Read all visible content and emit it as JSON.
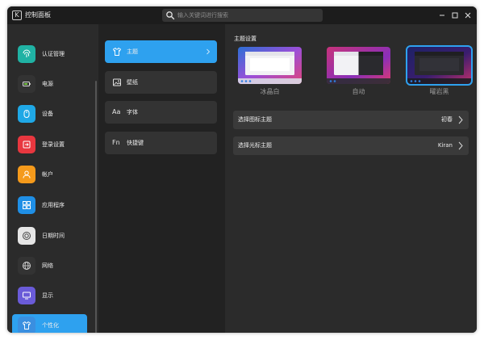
{
  "window": {
    "title": "控制面板",
    "logo_glyph": "K",
    "search_placeholder": "输入关键词进行搜索"
  },
  "sidebar": {
    "items": [
      {
        "label": "认证管理",
        "icon": "fingerprint-icon",
        "color": "#20b2a4"
      },
      {
        "label": "电源",
        "icon": "battery-icon",
        "color": "#333333"
      },
      {
        "label": "设备",
        "icon": "mouse-icon",
        "color": "#1fa8e6"
      },
      {
        "label": "登录设置",
        "icon": "login-icon",
        "color": "#e8373f"
      },
      {
        "label": "帐户",
        "icon": "user-icon",
        "color": "#f59a1b"
      },
      {
        "label": "应用程序",
        "icon": "apps-icon",
        "color": "#1f8fe6"
      },
      {
        "label": "日期时间",
        "icon": "clock-icon",
        "color": "#e6e6e6"
      },
      {
        "label": "网络",
        "icon": "globe-icon",
        "color": "#333333"
      },
      {
        "label": "显示",
        "icon": "monitor-icon",
        "color": "#6a5bd8"
      },
      {
        "label": "个性化",
        "icon": "shirt-icon",
        "color": "#3a8fe0"
      }
    ],
    "active_index": 9
  },
  "subpanel": {
    "items": [
      {
        "label": "主题",
        "icon": "shirt-icon"
      },
      {
        "label": "壁纸",
        "icon": "image-icon"
      },
      {
        "label": "字体",
        "icon": "font-icon",
        "glyph": "Aa"
      },
      {
        "label": "快捷键",
        "icon": "function-key-icon",
        "glyph": "Fn"
      }
    ],
    "active_index": 0
  },
  "main": {
    "section_title": "主题设置",
    "themes": [
      {
        "label": "冰晶白",
        "selected": false
      },
      {
        "label": "自动",
        "selected": false
      },
      {
        "label": "曜岩黑",
        "selected": true
      }
    ],
    "rows": [
      {
        "label": "选择图标主题",
        "value": "初春"
      },
      {
        "label": "选择光标主题",
        "value": "Kiran"
      }
    ]
  },
  "colors": {
    "accent": "#2ea1ef",
    "window_bg": "#222222",
    "panel_bg": "#2b2b2b"
  }
}
